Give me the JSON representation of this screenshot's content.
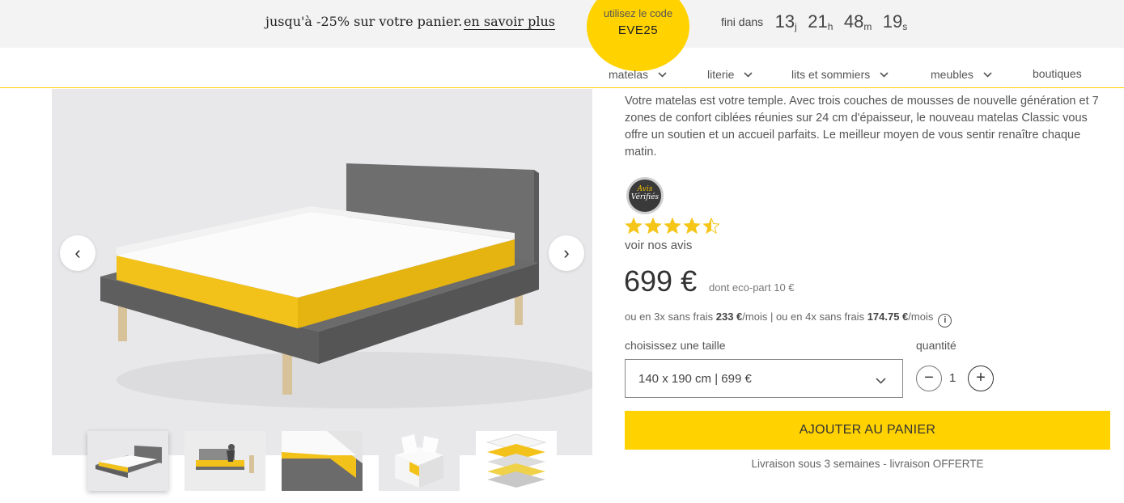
{
  "promo": {
    "text": "jusqu'à -25% sur votre panier.",
    "link": "en savoir plus",
    "code_label": "utilisez le code",
    "code": "EVE25",
    "countdown_label": "fini dans",
    "days": "13",
    "days_unit": "j",
    "hours": "21",
    "hours_unit": "h",
    "minutes": "48",
    "minutes_unit": "m",
    "seconds": "19",
    "seconds_unit": "s"
  },
  "nav": {
    "items": [
      {
        "label": "matelas"
      },
      {
        "label": "literie"
      },
      {
        "label": "lits et sommiers"
      },
      {
        "label": "meubles"
      },
      {
        "label": "boutiques"
      }
    ]
  },
  "product": {
    "description": "Votre matelas est votre temple. Avec trois couches de mousses de nouvelle génération et 7 zones de confort ciblées réunies sur 24 cm d'épaisseur, le nouveau matelas Classic vous offre un soutien et un accueil parfaits. Le meilleur moyen de vous sentir renaître chaque matin.",
    "badge_line1": "Avis",
    "badge_line2": "Vérifiés",
    "rating": 4.5,
    "rating_max": 5,
    "reviews_link": "voir nos avis",
    "price": "699 €",
    "eco_part": "dont eco-part 10 €",
    "inst_3x_pre": "ou en 3x sans frais ",
    "inst_3x_amount": "233 €",
    "inst_3x_post": "/mois",
    "inst_sep": " | ",
    "inst_4x_pre": "ou en 4x sans frais ",
    "inst_4x_amount": "174.75 €",
    "inst_4x_post": "/mois",
    "info_icon": "i",
    "size_label": "choisissez une taille",
    "size_value": "140 x 190 cm  |  699 €",
    "qty_label": "quantité",
    "qty_value": "1",
    "qty_minus": "−",
    "qty_plus": "+",
    "cart_button": "AJOUTER AU PANIER",
    "delivery": "Livraison sous 3 semaines - livraison OFFERTE"
  },
  "gallery": {
    "prev": "‹",
    "next": "›"
  },
  "colors": {
    "brand_yellow": "#ffd200",
    "bed_gray": "#6b6b6b",
    "background_gray": "#e8e8ea"
  }
}
